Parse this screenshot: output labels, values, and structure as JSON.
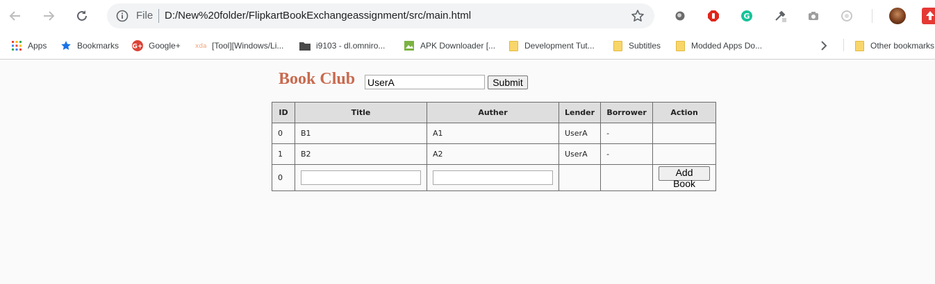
{
  "browser": {
    "address_scheme_label": "File",
    "url": "D:/New%20folder/FlipkartBookExchangeassignment/src/main.html"
  },
  "bookmarks": [
    {
      "label": "Apps",
      "icon": "apps-grid-icon"
    },
    {
      "label": "Bookmarks",
      "icon": "star-icon"
    },
    {
      "label": "Google+",
      "icon": "google-plus-icon"
    },
    {
      "label": "[Tool][Windows/Li...",
      "icon": "xda-icon"
    },
    {
      "label": "i9103 - dl.omniro...",
      "icon": "folder-dark-icon"
    },
    {
      "label": "APK Downloader [...",
      "icon": "image-icon"
    },
    {
      "label": "Development Tut...",
      "icon": "folder-icon"
    },
    {
      "label": "Subtitles",
      "icon": "folder-icon"
    },
    {
      "label": "Modded Apps Do...",
      "icon": "folder-icon"
    }
  ],
  "other_bookmarks": "Other bookmarks",
  "page": {
    "title": "Book Club",
    "user_value": "UserA",
    "submit_label": "Submit"
  },
  "table": {
    "headers": [
      "ID",
      "Title",
      "Auther",
      "Lender",
      "Borrower",
      "Action"
    ],
    "rows": [
      {
        "id": "0",
        "title": "B1",
        "auther": "A1",
        "lender": "UserA",
        "borrower": "-",
        "action": ""
      },
      {
        "id": "1",
        "title": "B2",
        "auther": "A2",
        "lender": "UserA",
        "borrower": "-",
        "action": ""
      }
    ],
    "new_row": {
      "id": "0",
      "title_value": "",
      "auther_value": "",
      "add_label": "Add Book"
    }
  },
  "colors": {
    "title": "#c96a4f",
    "header_bg": "#dedede",
    "page_bg": "#fafafa"
  }
}
